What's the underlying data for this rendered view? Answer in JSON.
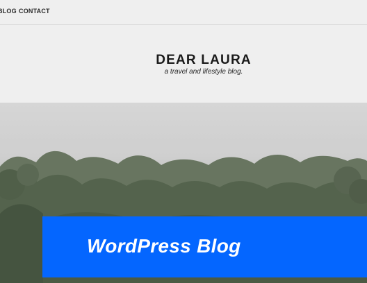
{
  "nav": {
    "items": [
      {
        "label": "BLOG"
      },
      {
        "label": "CONTACT"
      }
    ]
  },
  "header": {
    "title": "DEAR LAURA",
    "tagline": "a travel and lifestyle blog."
  },
  "banner": {
    "text": "WordPress Blog",
    "color": "#0466ff"
  },
  "hero": {
    "image": "hillside-trees-photo"
  }
}
